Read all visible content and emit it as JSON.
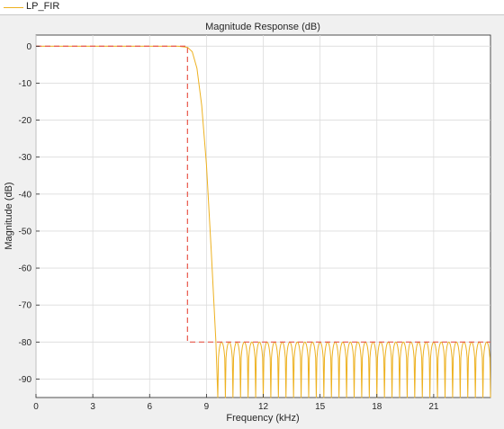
{
  "legend": {
    "label": "LP_FIR",
    "color": "#edb120"
  },
  "colors": {
    "response": "#edb120",
    "mask": "#e8574a",
    "grid": "#dcdcdc",
    "plot_bg": "#ffffff",
    "figure_bg": "#f0f0f0"
  },
  "chart_data": {
    "type": "line",
    "title": "Magnitude Response (dB)",
    "xlabel": "Frequency (kHz)",
    "ylabel": "Magnitude (dB)",
    "xlim": [
      0,
      24
    ],
    "ylim": [
      -95,
      3
    ],
    "xticks": [
      0,
      3,
      6,
      9,
      12,
      15,
      18,
      21
    ],
    "yticks": [
      0,
      -10,
      -20,
      -30,
      -40,
      -50,
      -60,
      -70,
      -80,
      -90
    ],
    "grid": true,
    "legend_position": "top-left",
    "series": [
      {
        "name": "LP_FIR",
        "color": "#edb120",
        "passband": {
          "x": [
            0,
            7.5,
            8.0
          ],
          "y": [
            0,
            0,
            -0.3
          ]
        },
        "transition": {
          "x": [
            8.0,
            8.25,
            8.5,
            8.75,
            9.0,
            9.25,
            9.5,
            9.6
          ],
          "y": [
            -0.3,
            -1.5,
            -6,
            -16,
            -32,
            -55,
            -80,
            -95
          ]
        },
        "stopband": {
          "start": 9.6,
          "end": 24,
          "ripple_count": 36,
          "peak": -80,
          "floor": -95
        }
      },
      {
        "name": "",
        "style": "dashed",
        "color": "#e8574a",
        "x": [
          0,
          8,
          8,
          24
        ],
        "y": [
          0,
          0,
          -80,
          -80
        ]
      }
    ]
  }
}
